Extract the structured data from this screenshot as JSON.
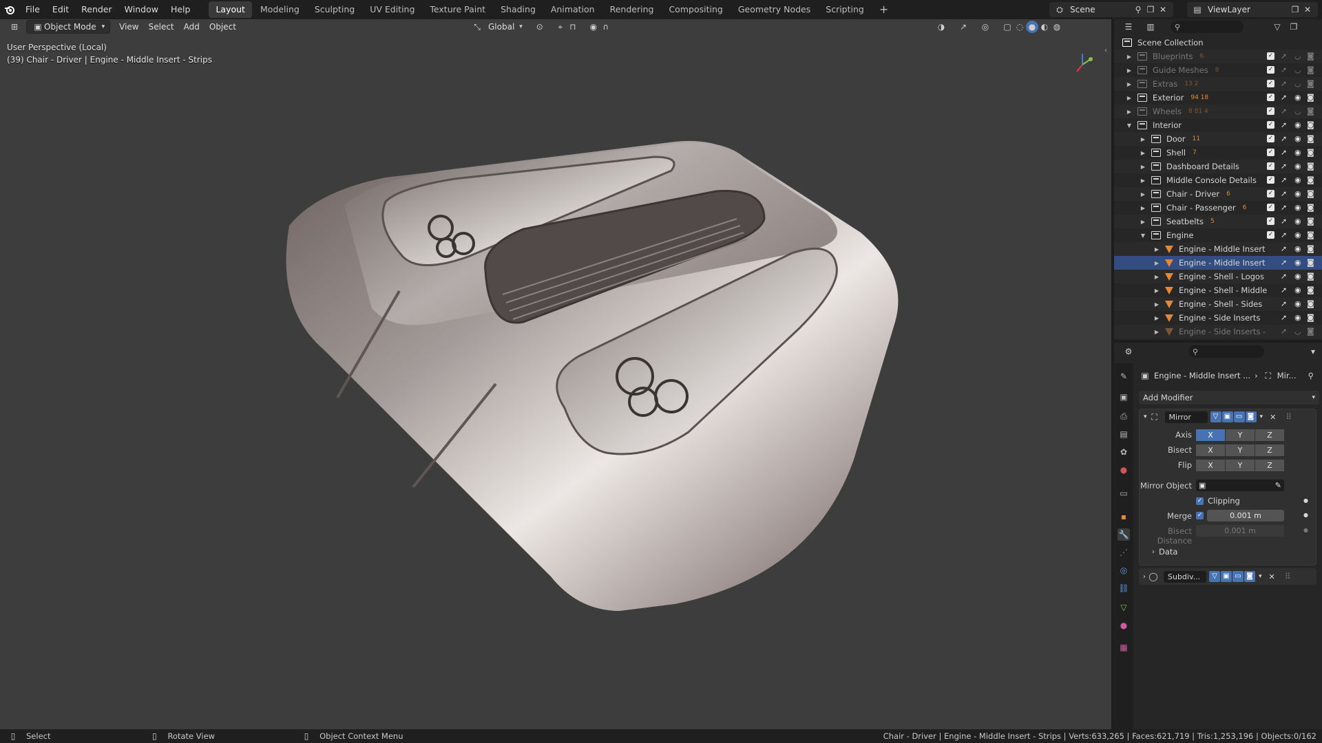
{
  "menu": [
    "File",
    "Edit",
    "Render",
    "Window",
    "Help"
  ],
  "workspaces": [
    "Layout",
    "Modeling",
    "Sculpting",
    "UV Editing",
    "Texture Paint",
    "Shading",
    "Animation",
    "Rendering",
    "Compositing",
    "Geometry Nodes",
    "Scripting"
  ],
  "active_workspace": "Layout",
  "scene_name": "Scene",
  "view_layer": "ViewLayer",
  "viewport": {
    "mode": "Object Mode",
    "menus": [
      "View",
      "Select",
      "Add",
      "Object"
    ],
    "transform_orientation": "Global",
    "perspective_label": "User Perspective (Local)",
    "object_label": "(39) Chair - Driver | Engine - Middle Insert - Strips"
  },
  "outliner": {
    "root": "Scene Collection",
    "rows": [
      {
        "label": "Blueprints",
        "badge": "6",
        "type": "collection",
        "dim": true
      },
      {
        "label": "Guide Meshes",
        "badge": "8",
        "type": "collection",
        "dim": true
      },
      {
        "label": "Extras",
        "badge": "13  2",
        "type": "collection",
        "dim": true
      },
      {
        "label": "Exterior",
        "badge": "94 18",
        "type": "collection",
        "dim": false
      },
      {
        "label": "Wheels",
        "badge": "8 81 4",
        "type": "collection",
        "dim": true
      },
      {
        "label": "Interior",
        "badge": "",
        "type": "collection",
        "dim": false
      },
      {
        "label": "Door",
        "badge": "11",
        "type": "collection",
        "dim": false
      },
      {
        "label": "Shell",
        "badge": "7",
        "type": "collection",
        "dim": false
      },
      {
        "label": "Dashboard Details",
        "badge": "",
        "type": "collection",
        "dim": false
      },
      {
        "label": "Middle Console Details",
        "badge": "",
        "type": "collection",
        "dim": false
      },
      {
        "label": "Chair - Driver",
        "badge": "6",
        "type": "collection",
        "dim": false
      },
      {
        "label": "Chair - Passenger",
        "badge": "6",
        "type": "collection",
        "dim": false
      },
      {
        "label": "Seatbelts",
        "badge": "5",
        "type": "collection",
        "dim": false
      },
      {
        "label": "Engine",
        "badge": "",
        "type": "collection",
        "dim": false
      },
      {
        "label": "Engine - Middle Insert",
        "badge": "",
        "type": "mesh",
        "dim": false
      },
      {
        "label": "Engine - Middle Insert",
        "badge": "",
        "type": "mesh",
        "dim": false
      },
      {
        "label": "Engine - Shell - Logos",
        "badge": "",
        "type": "mesh",
        "dim": false
      },
      {
        "label": "Engine - Shell - Middle",
        "badge": "",
        "type": "mesh",
        "dim": false
      },
      {
        "label": "Engine - Shell - Sides",
        "badge": "",
        "type": "mesh",
        "dim": false
      },
      {
        "label": "Engine - Side Inserts",
        "badge": "",
        "type": "mesh",
        "dim": false
      },
      {
        "label": "Engine - Side Inserts -",
        "badge": "",
        "type": "mesh",
        "dim": true
      }
    ]
  },
  "properties": {
    "breadcrumb_object": "Engine - Middle Insert ...",
    "breadcrumb_modifier": "Mir...",
    "add_modifier": "Add Modifier",
    "mirror": {
      "name": "Mirror",
      "axis_label": "Axis",
      "bisect_label": "Bisect",
      "flip_label": "Flip",
      "axes": [
        "X",
        "Y",
        "Z"
      ],
      "axis_on": "X",
      "mirror_object_label": "Mirror Object",
      "clipping_label": "Clipping",
      "merge_label": "Merge",
      "merge_value": "0.001 m",
      "bisect_distance_label": "Bisect Distance",
      "bisect_distance_value": "0.001 m",
      "data_label": "Data"
    },
    "subdiv": {
      "name": "Subdiv..."
    }
  },
  "status": {
    "select": "Select",
    "rotate": "Rotate View",
    "context": "Object Context Menu",
    "stats": "Chair - Driver | Engine - Middle Insert - Strips | Verts:633,265 | Faces:621,719 | Tris:1,253,196 | Objects:0/162"
  }
}
